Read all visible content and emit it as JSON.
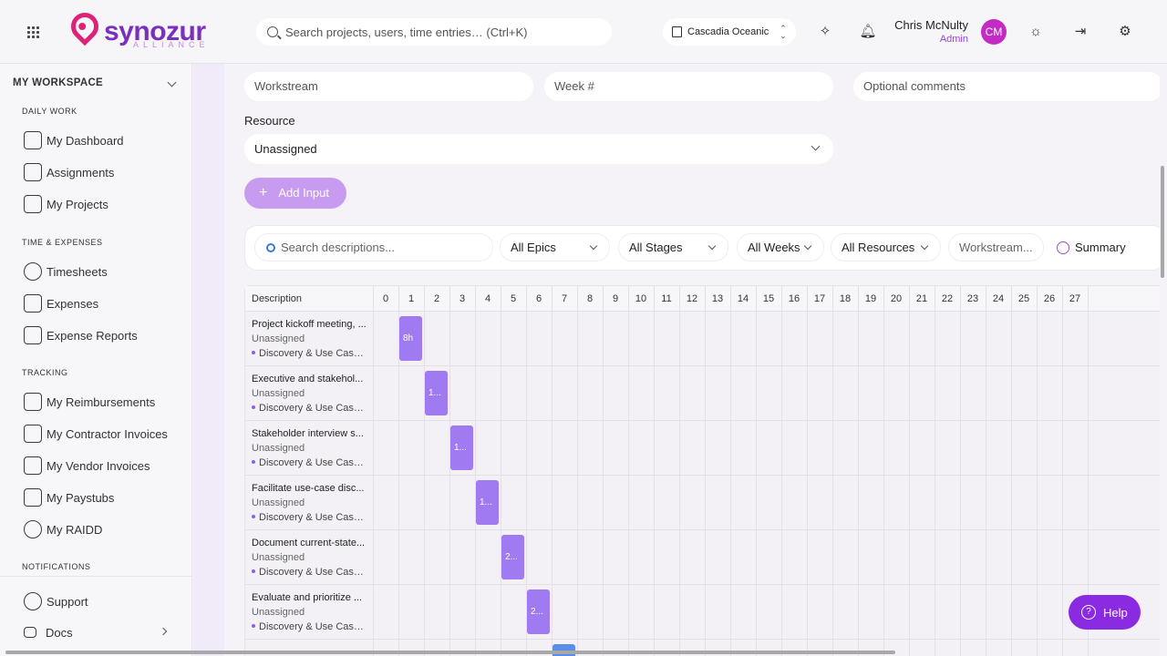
{
  "header": {
    "logo_text": "synozur",
    "logo_sub": "ALLIANCE",
    "search_placeholder": "Search projects, users, time entries… (Ctrl+K)",
    "tenant": "Cascadia Oceanic",
    "user_name": "Chris McNulty",
    "user_role": "Admin",
    "avatar_initials": "CM"
  },
  "sidebar": {
    "workspace_title": "MY WORKSPACE",
    "sections": {
      "daily": "DAILY WORK",
      "time": "TIME & EXPENSES",
      "tracking": "TRACKING",
      "notifications": "NOTIFICATIONS"
    },
    "items": {
      "dashboard": "My Dashboard",
      "assignments": "Assignments",
      "projects": "My Projects",
      "timesheets": "Timesheets",
      "expenses": "Expenses",
      "expense_reports": "Expense Reports",
      "reimbursements": "My Reimbursements",
      "contractor_invoices": "My Contractor Invoices",
      "vendor_invoices": "My Vendor Invoices",
      "paystubs": "My Paystubs",
      "raidd": "My RAIDD",
      "support": "Support",
      "docs": "Docs"
    }
  },
  "form": {
    "workstream_placeholder": "Workstream",
    "week_placeholder": "Week #",
    "comments_placeholder": "Optional comments",
    "resource_label": "Resource",
    "resource_value": "Unassigned",
    "add_button": "Add Input"
  },
  "filters": {
    "search_placeholder": "Search descriptions...",
    "epics": "All Epics",
    "stages": "All Stages",
    "weeks": "All Weeks",
    "resources": "All Resources",
    "workstream": "Workstream...",
    "summary": "Summary"
  },
  "gantt": {
    "description_header": "Description",
    "weeks": [
      "0",
      "1",
      "2",
      "3",
      "4",
      "5",
      "6",
      "7",
      "8",
      "9",
      "10",
      "11",
      "12",
      "13",
      "14",
      "15",
      "16",
      "17",
      "18",
      "19",
      "20",
      "21",
      "22",
      "23",
      "24",
      "25",
      "26",
      "27"
    ],
    "rows": [
      {
        "title": "Project kickoff meeting, ...",
        "resource": "Unassigned",
        "epic": "Discovery & Use Case ...",
        "week": 1,
        "label": "8h"
      },
      {
        "title": "Executive and stakehol...",
        "resource": "Unassigned",
        "epic": "Discovery & Use Case ...",
        "week": 2,
        "label": "1..."
      },
      {
        "title": "Stakeholder interview s...",
        "resource": "Unassigned",
        "epic": "Discovery & Use Case ...",
        "week": 3,
        "label": "1..."
      },
      {
        "title": "Facilitate use-case disc...",
        "resource": "Unassigned",
        "epic": "Discovery & Use Case ...",
        "week": 4,
        "label": "1..."
      },
      {
        "title": "Document current-state...",
        "resource": "Unassigned",
        "epic": "Discovery & Use Case ...",
        "week": 5,
        "label": "2..."
      },
      {
        "title": "Evaluate and prioritize ...",
        "resource": "Unassigned",
        "epic": "Discovery & Use Case ...",
        "week": 6,
        "label": "2..."
      }
    ]
  },
  "help": "Help",
  "colors": {
    "brand": "#7a2fbd",
    "accent": "#a07af0",
    "help": "#8a2be2"
  }
}
